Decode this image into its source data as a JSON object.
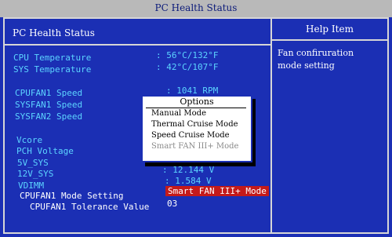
{
  "header": {
    "title": "PC Health Status"
  },
  "left_panel": {
    "title": "PC Health Status"
  },
  "right_panel": {
    "title": "Help Item",
    "help_line1": "Fan confiruration",
    "help_line2": "mode setting"
  },
  "rows": {
    "cpu_temp_label": "CPU Temperature",
    "cpu_temp_value": ": 56°C/132°F",
    "sys_temp_label": "SYS Temperature",
    "sys_temp_value": ": 42°C/107°F",
    "cpufan1_label": "CPUFAN1 Speed",
    "cpufan1_value": ": 1041 RPM",
    "sysfan1_label": "SYSFAN1 Speed",
    "sysfan2_label": "SYSFAN2 Speed",
    "vcore_label": "Vcore",
    "pch_label": "PCH Voltage",
    "v5_label": "5V_SYS",
    "v12_label": "12V_SYS",
    "v12_value": ": 12.144 V",
    "vdimm_label": "VDIMM",
    "vdimm_value": ": 1.584 V",
    "mode_label": "CPUFAN1 Mode Setting",
    "mode_value": "Smart FAN III+ Mode",
    "tolerance_label": "CPUFAN1 Tolerance Value",
    "tolerance_value": "03"
  },
  "options_popup": {
    "title": "Options",
    "items": [
      "Manual Mode",
      "Thermal Cruise Mode",
      "Speed Cruise Mode",
      "Smart FAN III+ Mode"
    ]
  },
  "colors": {
    "background": "#1b2fb4",
    "label_cyan": "#5cd4ff",
    "selected_red": "#c41a1a"
  }
}
